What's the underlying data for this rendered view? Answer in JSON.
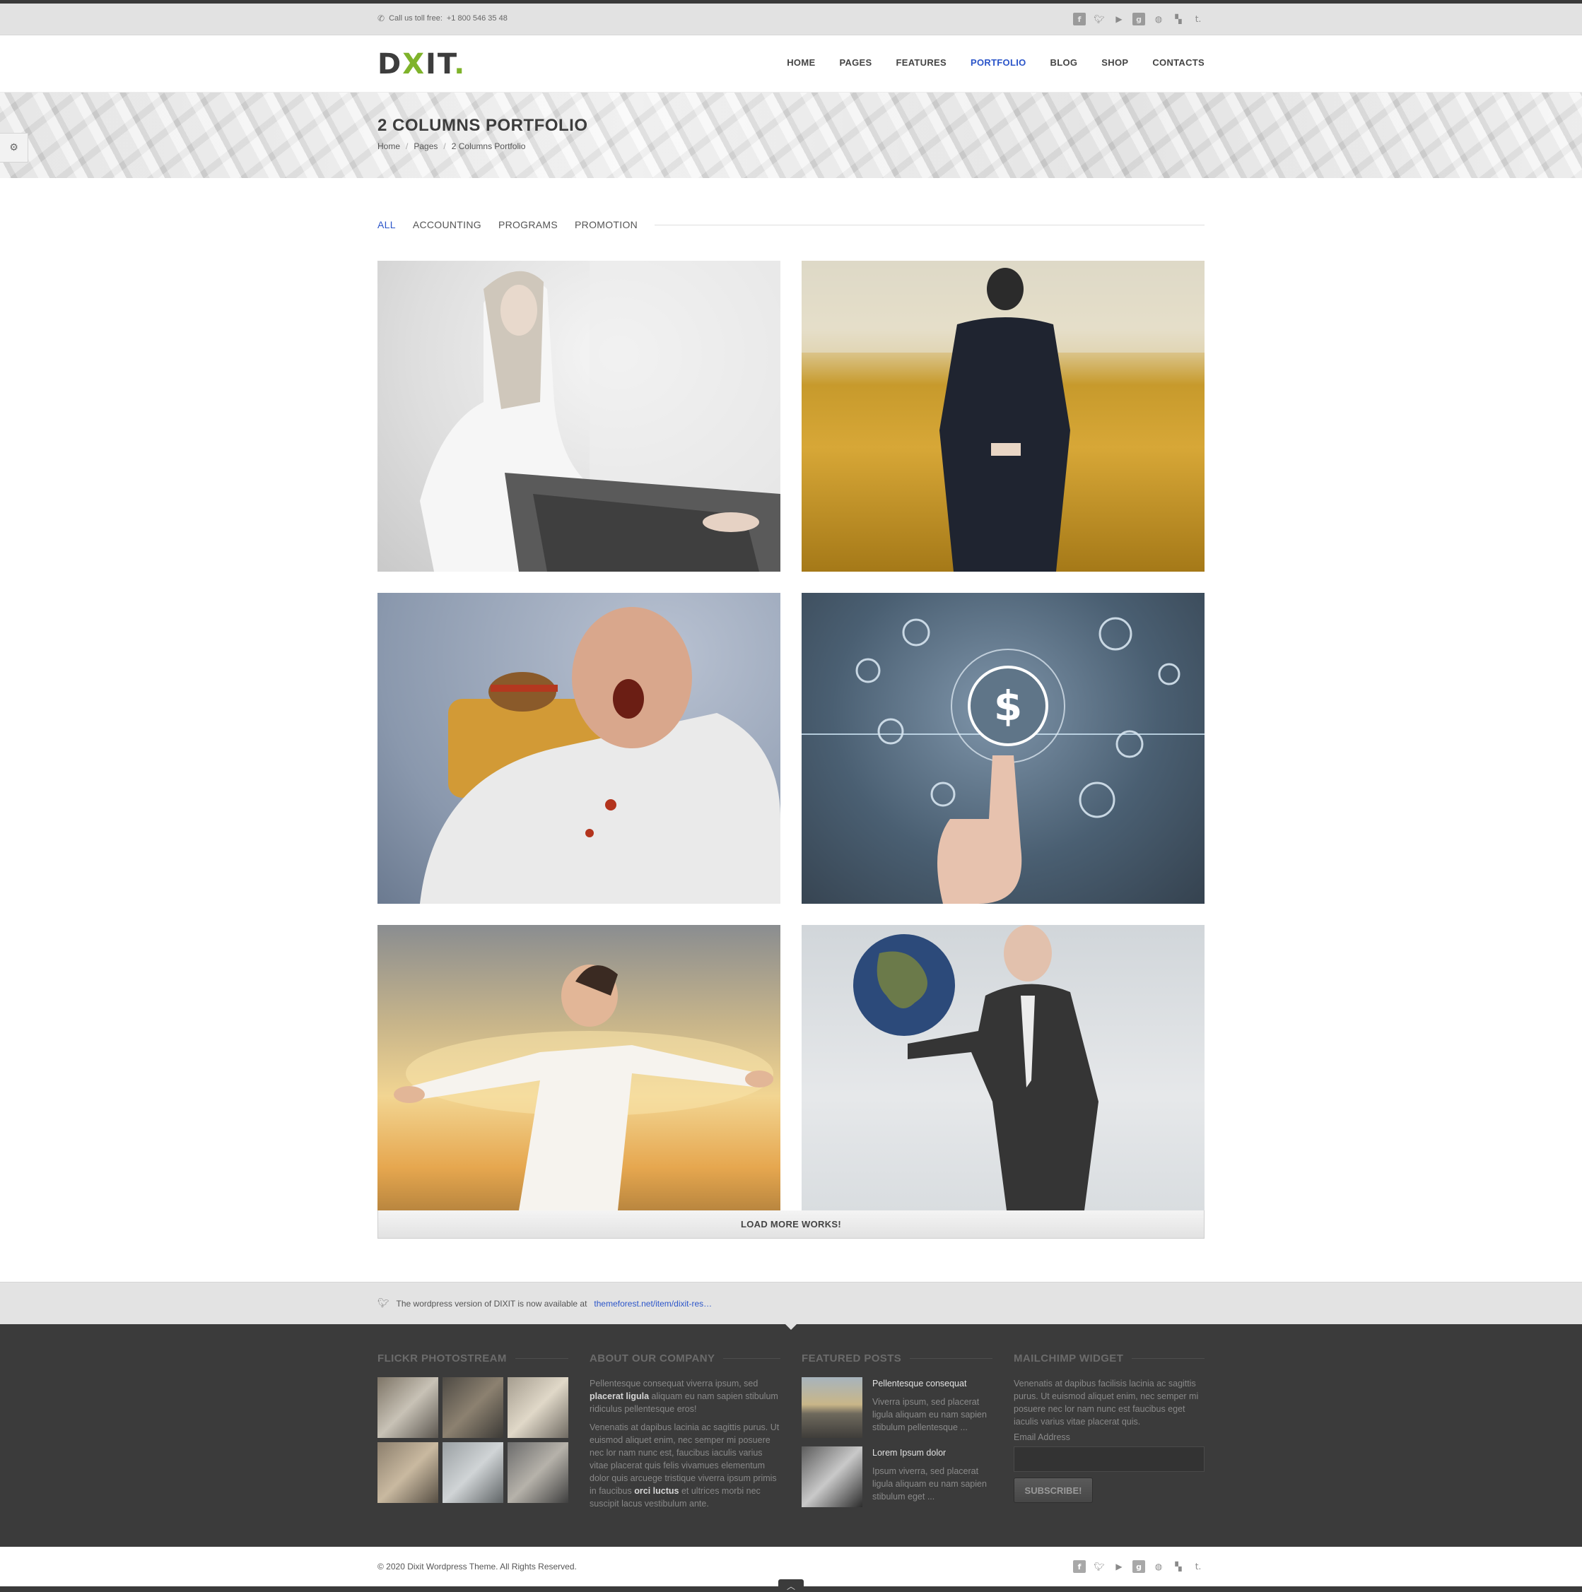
{
  "topbar": {
    "phone_label": "Call us toll free:",
    "phone_number": "+1 800 546 35 48",
    "social_icons": [
      "facebook-icon",
      "twitter-icon",
      "youtube-icon",
      "google-plus-icon",
      "dribbble-icon",
      "delicious-icon",
      "tumblr-icon"
    ]
  },
  "header": {
    "logo": {
      "d": "D",
      "x": "X",
      "it": "IT",
      "dot": "."
    },
    "nav": [
      {
        "label": "HOME",
        "active": false
      },
      {
        "label": "PAGES",
        "active": false
      },
      {
        "label": "FEATURES",
        "active": false
      },
      {
        "label": "PORTFOLIO",
        "active": true
      },
      {
        "label": "BLOG",
        "active": false
      },
      {
        "label": "SHOP",
        "active": false
      },
      {
        "label": "CONTACTS",
        "active": false
      }
    ]
  },
  "banner": {
    "title": "2 COLUMNS PORTFOLIO",
    "breadcrumb": [
      "Home",
      "Pages",
      "2 Columns Portfolio"
    ]
  },
  "filters": [
    {
      "label": "ALL",
      "active": true
    },
    {
      "label": "ACCOUNTING",
      "active": false
    },
    {
      "label": "PROGRAMS",
      "active": false
    },
    {
      "label": "PROMOTION",
      "active": false
    }
  ],
  "portfolio": {
    "items": [
      "woman-on-chair-photo",
      "businessman-in-wheat-field-photo",
      "man-eating-burger-photo",
      "finger-touching-dollar-icons-photo",
      "man-arms-open-sky-photo",
      "old-man-holding-earth-photo"
    ],
    "load_more": "LOAD MORE WORKS!"
  },
  "tweet": {
    "text": "The wordpress version of DIXIT is now available at",
    "link": "themeforest.net/item/dixit-res…"
  },
  "footer": {
    "flickr_title": "FLICKR PHOTOSTREAM",
    "about_title": "ABOUT OUR COMPANY",
    "about_p1_a": "Pellentesque consequat viverra ipsum, sed",
    "about_p1_b": "placerat ligula",
    "about_p1_c": "aliquam eu nam sapien stibulum ridiculus pellentesque eros!",
    "about_p2_a": "Venenatis at dapibus lacinia ac sagittis purus. Ut euismod aliquet enim, nec semper mi posuere nec lor nam nunc est, faucibus iaculis varius vitae placerat quis felis vivamues elementum dolor quis arcuege tristique viverra ipsum primis in faucibus",
    "about_p2_b": "orci luctus",
    "about_p2_c": "et ultrices morbi nec suscipit lacus vestibulum ante.",
    "featured_title": "FEATURED POSTS",
    "posts": [
      {
        "title": "Pellentesque consequat",
        "text": "Viverra ipsum, sed placerat ligula aliquam eu nam sapien stibulum pellentesque ..."
      },
      {
        "title": "Lorem Ipsum dolor",
        "text": "Ipsum viverra, sed placerat ligula aliquam eu nam sapien stibulum eget ..."
      }
    ],
    "mailchimp_title": "MAILCHIMP WIDGET",
    "mailchimp_text": "Venenatis at dapibus facilisis lacinia ac sagittis purus. Ut euismod aliquet enim, nec semper mi posuere nec lor nam nunc est faucibus eget iaculis varius vitae placerat quis.",
    "email_label": "Email Address",
    "subscribe": "SUBSCRIBE!"
  },
  "bottom": {
    "copyright": "© 2020 Dixit Wordpress Theme. All Rights Reserved."
  }
}
